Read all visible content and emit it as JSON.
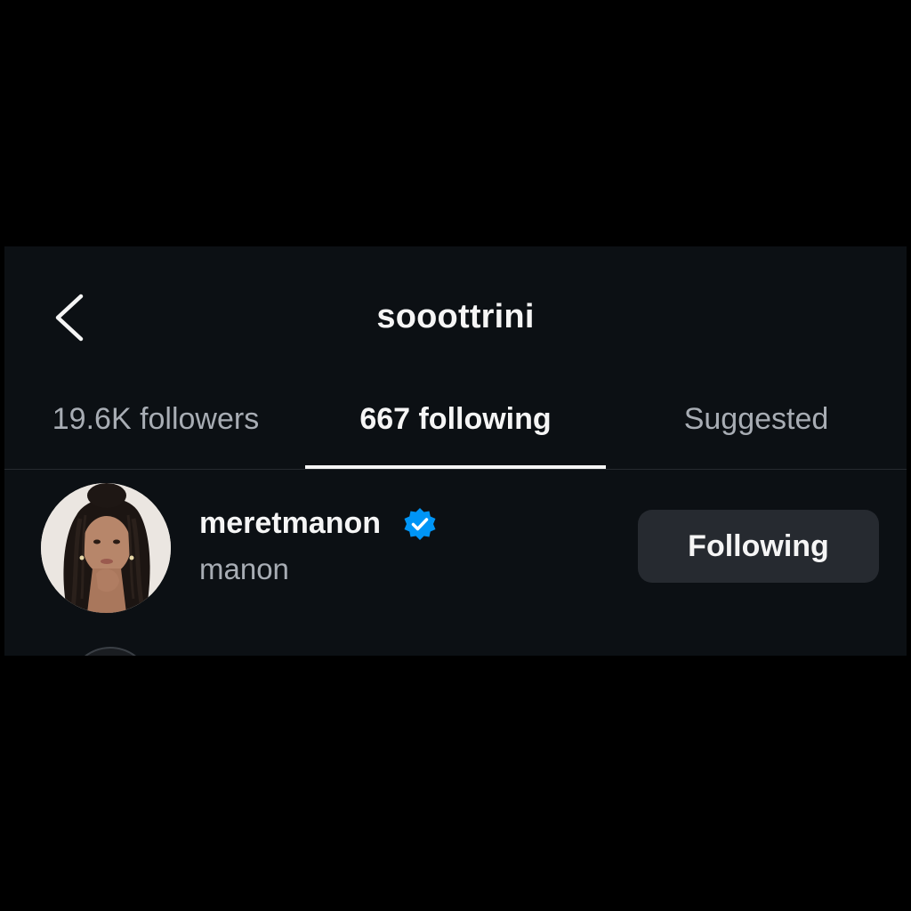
{
  "header": {
    "title": "sooottrini",
    "back_icon": "chevron-left-icon"
  },
  "tabs": [
    {
      "label": "19.6K followers",
      "active": false
    },
    {
      "label": "667 following",
      "active": true
    },
    {
      "label": "Suggested",
      "active": false
    }
  ],
  "list": [
    {
      "username": "meretmanon",
      "full_name": "manon",
      "verified": true,
      "button_label": "Following"
    }
  ],
  "colors": {
    "background": "#0c1014",
    "text_primary": "#f5f5f5",
    "text_secondary": "#a8adb4",
    "button_bg": "#262a30",
    "verified_blue": "#0095f6"
  }
}
